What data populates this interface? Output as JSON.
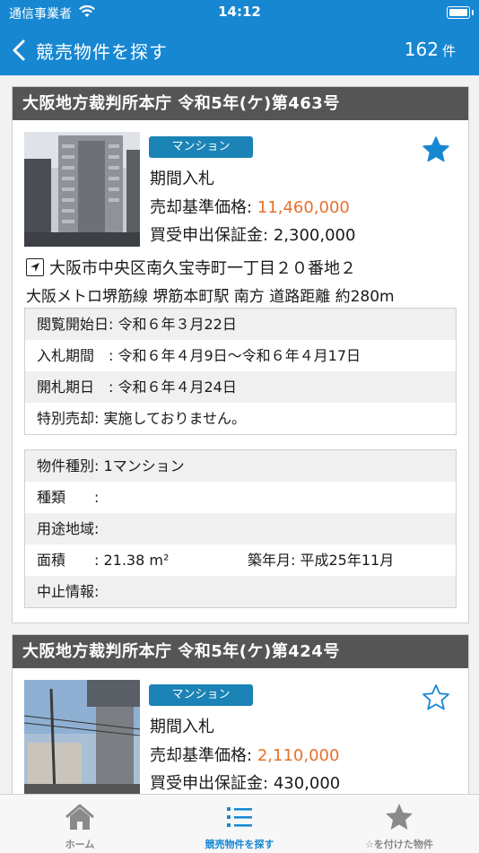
{
  "status": {
    "carrier": "通信事業者",
    "time": "14:12"
  },
  "nav": {
    "back_label": "競売物件を探す",
    "count": "162",
    "count_unit": "件"
  },
  "listings": [
    {
      "court": "大阪地方裁判所本庁 令和5年(ケ)第463号",
      "type_badge": "マンション",
      "sale_method": "期間入札",
      "base_price_label": "売却基準価格:",
      "base_price": "11,460,000",
      "deposit_label": "買受申出保証金:",
      "deposit": "2,300,000",
      "favorited": true,
      "address": "大阪市中央区南久宝寺町一丁目２０番地２",
      "station": "大阪メトロ堺筋線 堺筋本町駅 南方 道路距離 約280m",
      "schedule": [
        "閲覧開始日: 令和６年３月22日",
        "入札期間　: 令和６年４月9日～令和６年４月17日",
        "開札期日　: 令和６年４月24日",
        "特別売却: 実施しておりません。"
      ],
      "details": {
        "kind": "物件種別: 1マンション",
        "type": "種類　　:",
        "use": "用途地域:",
        "area": "面積　　: 21.38 m²",
        "built": "築年月: 平成25年11月",
        "cancel": "中止情報:"
      }
    },
    {
      "court": "大阪地方裁判所本庁 令和5年(ケ)第424号",
      "type_badge": "マンション",
      "sale_method": "期間入札",
      "base_price_label": "売却基準価格:",
      "base_price": "2,110,000",
      "deposit_label": "買受申出保証金:",
      "deposit": "430,000",
      "favorited": false
    }
  ],
  "tabs": [
    {
      "label": "ホーム",
      "icon": "home-icon"
    },
    {
      "label": "競売物件を探す",
      "icon": "list-icon"
    },
    {
      "label": "☆を付けた物件",
      "icon": "star-icon"
    }
  ],
  "colors": {
    "accent": "#1787d2",
    "price": "#e8702a",
    "badge": "#1b83b5",
    "header": "#555555"
  }
}
